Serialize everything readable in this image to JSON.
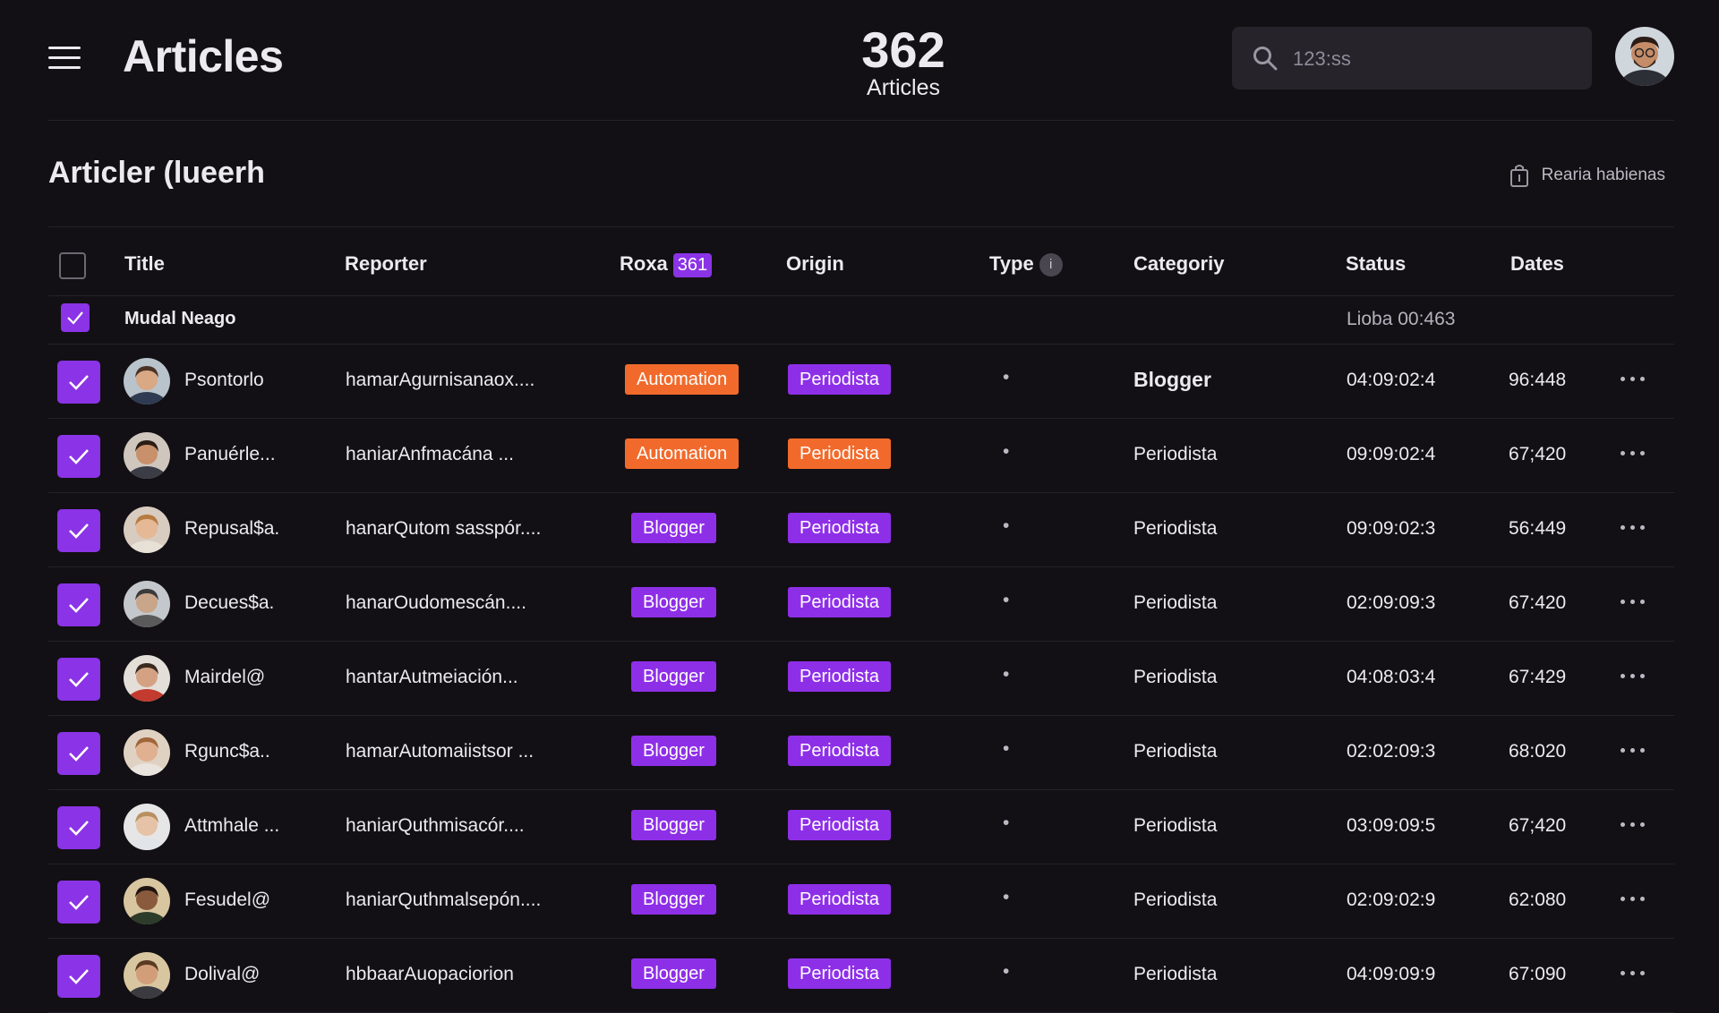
{
  "header": {
    "title": "Articles",
    "counter_value": "362",
    "counter_label": "Articles",
    "search_value": "123:ss",
    "avatar": "avatar"
  },
  "section": {
    "title": "Articler (luеerh",
    "action_label": "Rearia habienas",
    "action_icon": "bag-icon"
  },
  "table": {
    "columns": {
      "title": "Title",
      "reporter": "Reporter",
      "roxa": "Roxa",
      "roxa_count": "361",
      "origin": "Origin",
      "type": "Type",
      "type_info": "i",
      "category": "Categoriy",
      "status": "Status",
      "dates": "Dates"
    },
    "group": {
      "name": "Mudal Neago",
      "meta": "Lioba 00:463"
    },
    "rows": [
      {
        "title": "Psontorlo",
        "reporter": "hamarAgurnisanaoх....",
        "roxa": "Automation",
        "roxa_color": "orange",
        "origin": "Periodista",
        "origin_color": "purple",
        "type": "•",
        "category": "Blogger",
        "category_bold": true,
        "status": "04:09:02:4",
        "dates": "96:448"
      },
      {
        "title": "Panuérle...",
        "reporter": "haniarAnfmacána ...",
        "roxa": "Automation",
        "roxa_color": "orange",
        "origin": "Periodista",
        "origin_color": "orange",
        "type": "•",
        "category": "Periodista",
        "category_bold": false,
        "status": "09:09:02:4",
        "dates": "67;420"
      },
      {
        "title": "Repusal$a.",
        "reporter": "hanarQutom sasspór....",
        "roxa": "Blogger",
        "roxa_color": "purple",
        "origin": "Periodista",
        "origin_color": "purple",
        "type": "•",
        "category": "Periodista",
        "category_bold": false,
        "status": "09:09:02:3",
        "dates": "56:449"
      },
      {
        "title": "Decues$a.",
        "reporter": "hanarOudomescán....",
        "roxa": "Blogger",
        "roxa_color": "purple",
        "origin": "Periodista",
        "origin_color": "purple",
        "type": "•",
        "category": "Periodista",
        "category_bold": false,
        "status": "02:09:09:3",
        "dates": "67:420"
      },
      {
        "title": "Mairdel@",
        "reporter": "hantarAutmeiación...",
        "roxa": "Blogger",
        "roxa_color": "purple",
        "origin": "Periodista",
        "origin_color": "purple",
        "type": "•",
        "category": "Periodista",
        "category_bold": false,
        "status": "04:08:03:4",
        "dates": "67:429"
      },
      {
        "title": "Rgunc$a..",
        "reporter": "hamarAutomaiistsor ...",
        "roxa": "Blogger",
        "roxa_color": "purple",
        "origin": "Periodista",
        "origin_color": "purple",
        "type": "•",
        "category": "Periodista",
        "category_bold": false,
        "status": "02:02:09:3",
        "dates": "68:020"
      },
      {
        "title": "Attmhale ...",
        "reporter": "haniarQuthmisacór....",
        "roxa": "Blogger",
        "roxa_color": "purple",
        "origin": "Periodista",
        "origin_color": "purple",
        "type": "•",
        "category": "Periodista",
        "category_bold": false,
        "status": "03:09:09:5",
        "dates": "67;420"
      },
      {
        "title": "Fesudel@",
        "reporter": "haniarQuthmalsepón....",
        "roxa": "Blogger",
        "roxa_color": "purple",
        "origin": "Periodista",
        "origin_color": "purple",
        "type": "•",
        "category": "Periodista",
        "category_bold": false,
        "status": "02:09:02:9",
        "dates": "62:080"
      },
      {
        "title": "Dolival@",
        "reporter": "hbbaarAuopaciorion",
        "roxa": "Blogger",
        "roxa_color": "purple",
        "origin": "Periodista",
        "origin_color": "purple",
        "type": "•",
        "category": "Periodista",
        "category_bold": false,
        "status": "04:09:09:9",
        "dates": "67:090"
      }
    ]
  },
  "colors": {
    "background": "#121014",
    "accent": "#8b33e6",
    "orange": "#f26a2b",
    "search_bg": "#26232b"
  }
}
